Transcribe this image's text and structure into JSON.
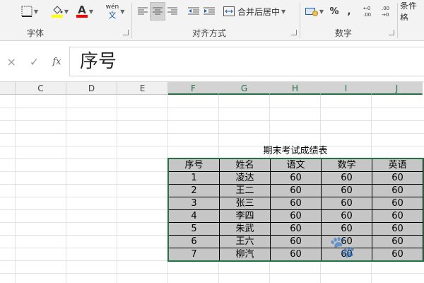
{
  "ribbon": {
    "groups": {
      "font_label": "字体",
      "align_label": "对齐方式",
      "number_label": "数字"
    },
    "wen_label": "wén",
    "wen_char": "文",
    "merge_label": "合并后居中",
    "percent": "%",
    "comma": ",",
    "cond_format": "条件格",
    "font_color": "#ff0000",
    "fill_color": "#ffff00"
  },
  "formula_bar": {
    "value": "序号",
    "fx": "fx",
    "cancel_glyph": "×",
    "enter_glyph": "✓"
  },
  "columns": [
    "C",
    "D",
    "E",
    "F",
    "G",
    "H",
    "I",
    "J"
  ],
  "selected_columns": [
    "F",
    "G",
    "H",
    "I",
    "J"
  ],
  "table": {
    "title": "期末考试成绩表",
    "headers": [
      "序号",
      "姓名",
      "语文",
      "数学",
      "英语"
    ],
    "rows": [
      [
        "1",
        "凌达",
        "60",
        "60",
        "60"
      ],
      [
        "2",
        "王二",
        "60",
        "60",
        "60"
      ],
      [
        "3",
        "张三",
        "60",
        "60",
        "60"
      ],
      [
        "4",
        "李四",
        "60",
        "60",
        "60"
      ],
      [
        "5",
        "朱武",
        "60",
        "60",
        "60"
      ],
      [
        "6",
        "王六",
        "60",
        "60",
        "60"
      ],
      [
        "7",
        "柳汽",
        "60",
        "60",
        "60"
      ]
    ]
  }
}
